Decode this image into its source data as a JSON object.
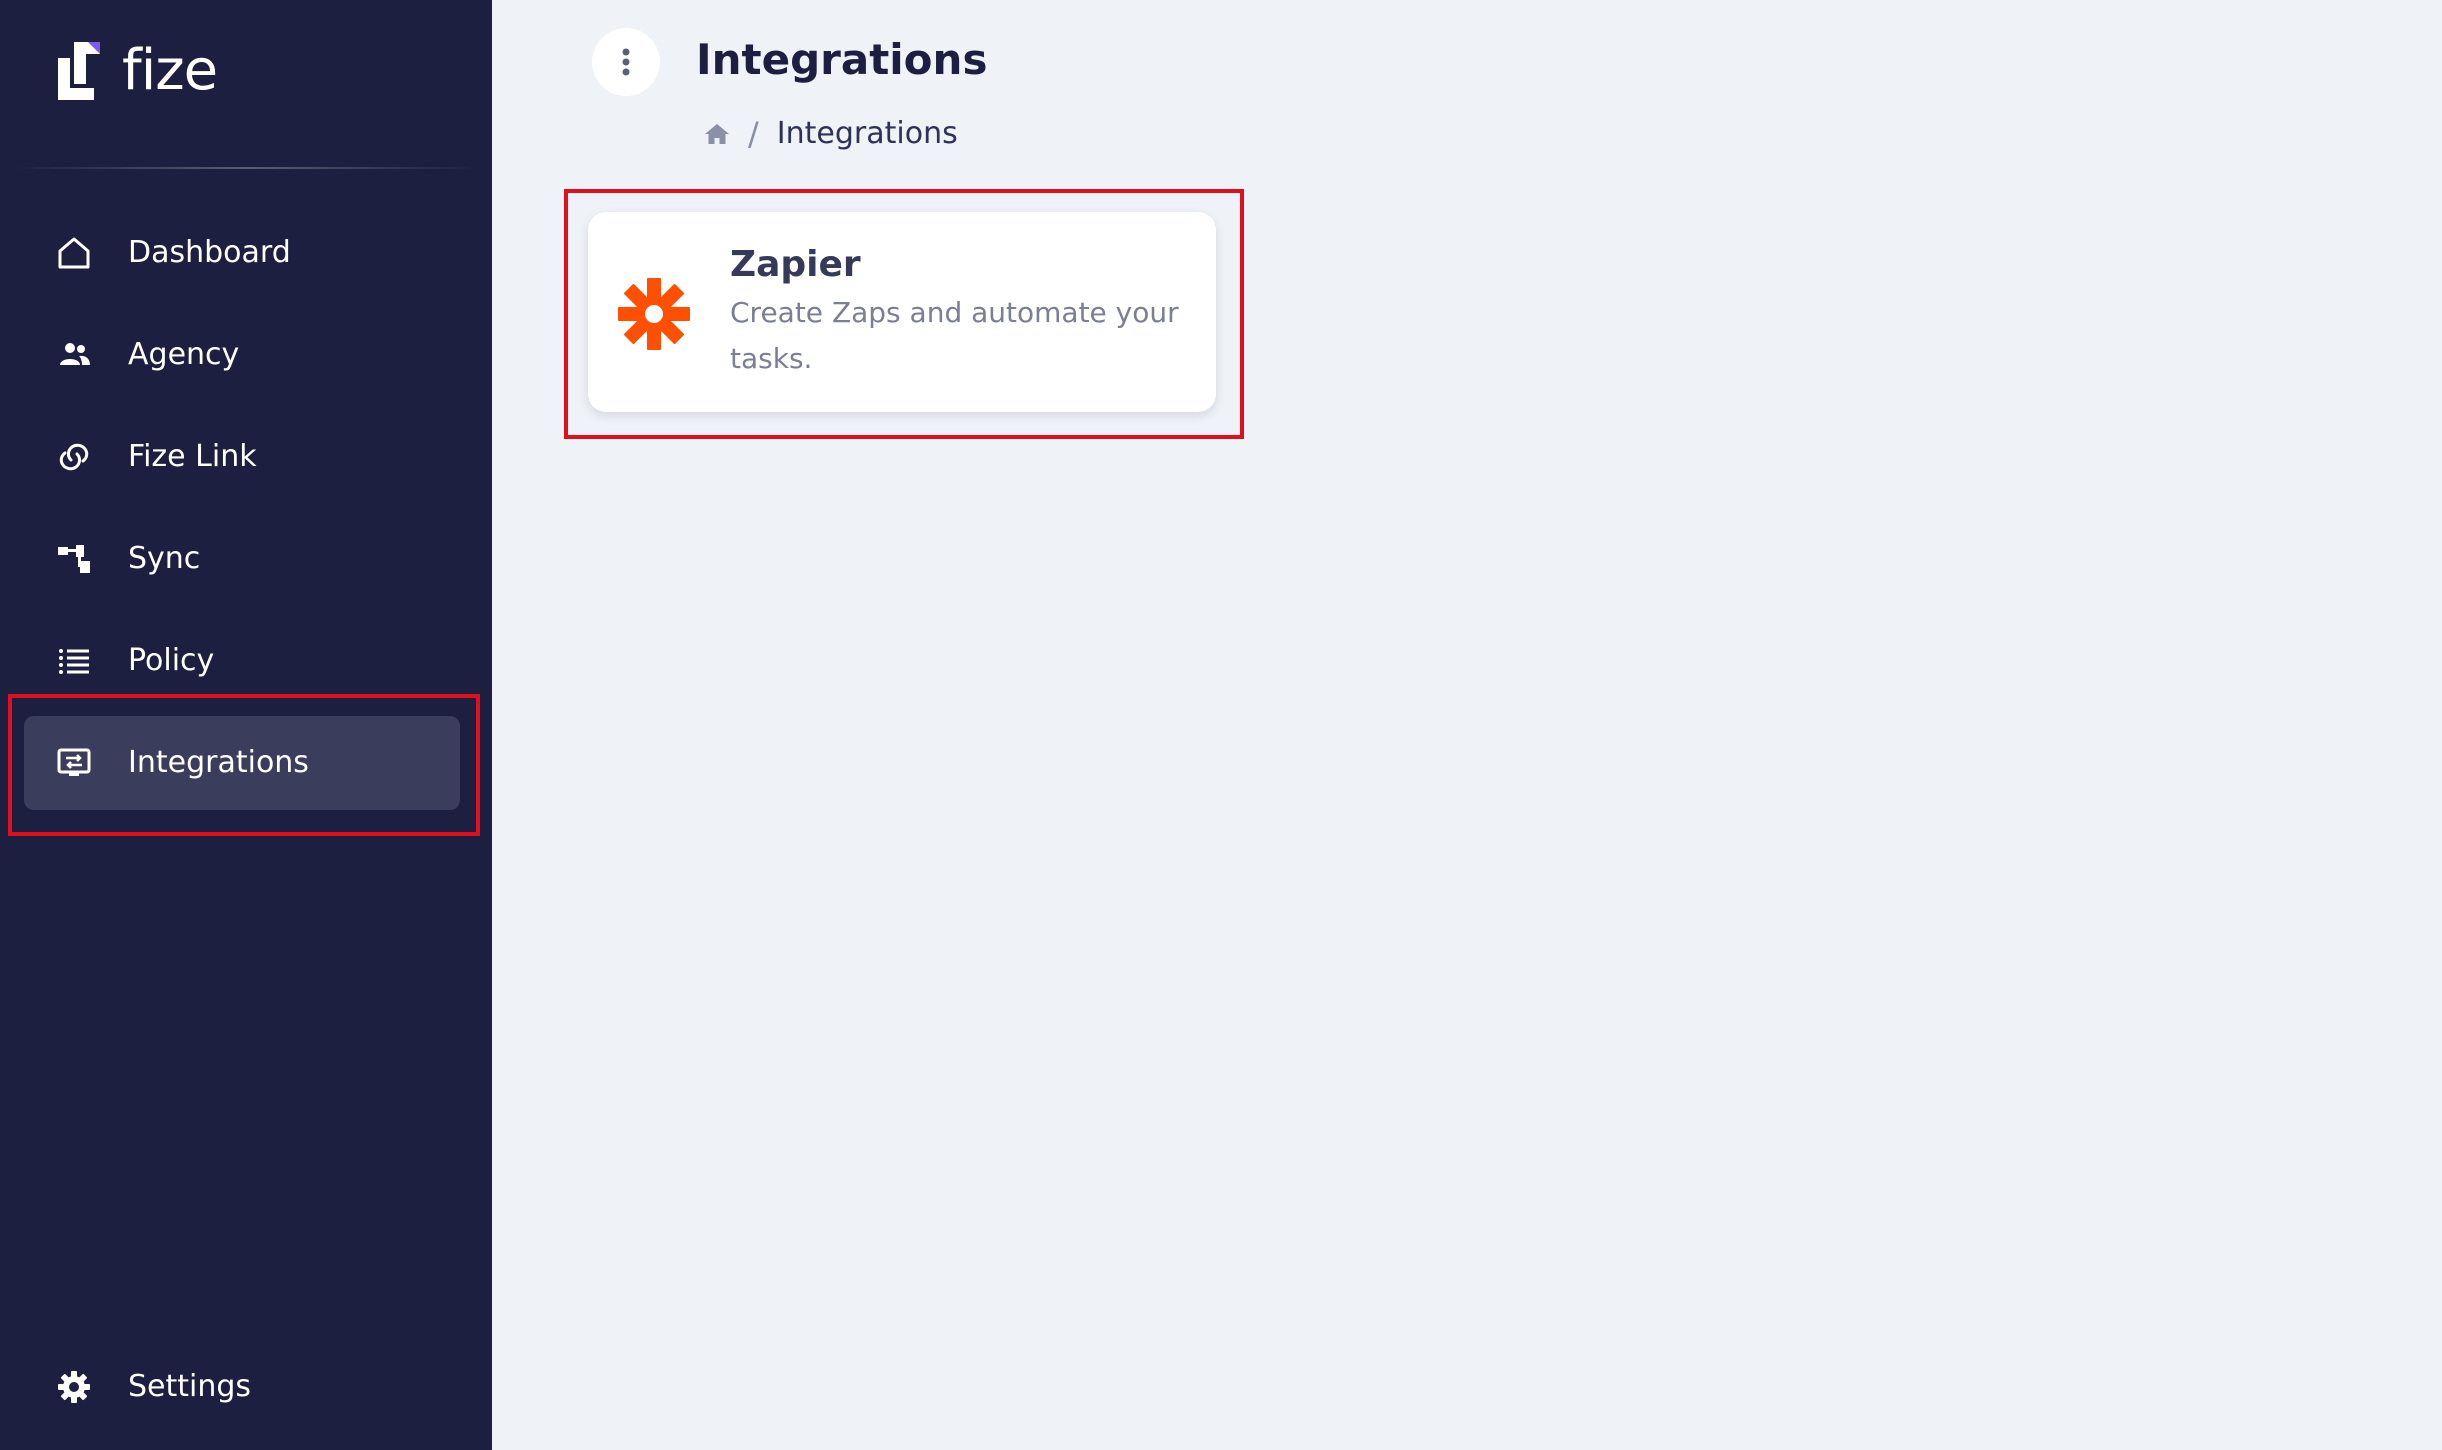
{
  "brand": {
    "name": "fize",
    "accent": "#7b5cf0"
  },
  "sidebar": {
    "items": [
      {
        "label": "Dashboard",
        "icon": "home-icon"
      },
      {
        "label": "Agency",
        "icon": "people-icon"
      },
      {
        "label": "Fize Link",
        "icon": "link-icon"
      },
      {
        "label": "Sync",
        "icon": "sync-icon"
      },
      {
        "label": "Policy",
        "icon": "list-icon"
      },
      {
        "label": "Integrations",
        "icon": "integrations-icon",
        "active": true
      }
    ],
    "settings": {
      "label": "Settings",
      "icon": "gear-icon"
    }
  },
  "header": {
    "title": "Integrations",
    "breadcrumb": {
      "home_icon": "home-icon",
      "separator": "/",
      "current": "Integrations"
    }
  },
  "integrations": [
    {
      "name": "Zapier",
      "description": "Create Zaps and automate your tasks.",
      "icon": "zapier-icon",
      "icon_color": "#ff4f00"
    }
  ],
  "colors": {
    "sidebar_bg": "#1c1f3f",
    "active_item_bg": "#3a3d5c",
    "content_bg": "#eff2f6",
    "highlight": "#e10e1c"
  }
}
